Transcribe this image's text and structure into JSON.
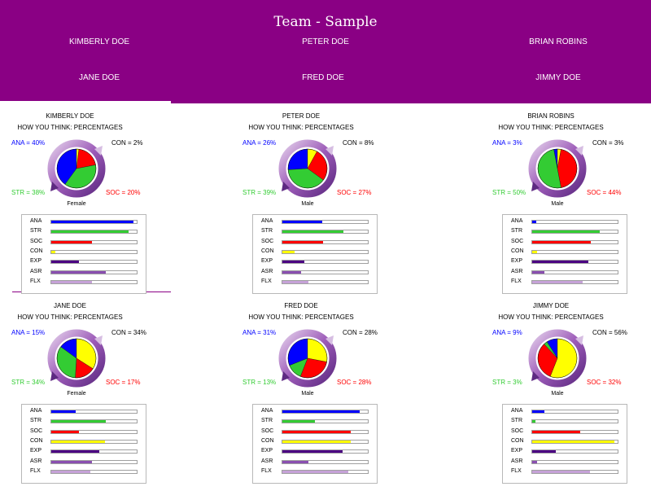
{
  "title": "Team - Sample",
  "nav": [
    "KIMBERLY DOE",
    "PETER DOE",
    "BRIAN ROBINS",
    "JANE DOE",
    "FRED DOE",
    "JIMMY DOE"
  ],
  "subtitle": "HOW YOU THINK: PERCENTAGES",
  "colors": {
    "header": "#8a0084",
    "ANA": "#0000ff",
    "STR": "#33cc33",
    "SOC": "#ff0000",
    "CON": "#ffff00",
    "EXP": "#4b0082",
    "ASR": "#8a4fb0",
    "FLX": "#c6a2d8",
    "CON_label": "#cccc00"
  },
  "bar_labels": [
    "ANA",
    "STR",
    "SOC",
    "CON",
    "EXP",
    "ASR",
    "FLX"
  ],
  "people": [
    {
      "name": "KIMBERLY DOE",
      "gender": "Female",
      "pct": {
        "ANA": "ANA = 40%",
        "CON": "CON = 2%",
        "STR": "STR = 38%",
        "SOC": "SOC = 20%"
      },
      "pie": {
        "ANA": 40,
        "CON": 2,
        "SOC": 20,
        "STR": 38
      },
      "bars": [
        0.96,
        0.9,
        0.48,
        0.05,
        0.32,
        0.64,
        0.48
      ]
    },
    {
      "name": "PETER DOE",
      "gender": "Male",
      "pct": {
        "ANA": "ANA = 26%",
        "CON": "CON = 8%",
        "STR": "STR = 39%",
        "SOC": "SOC = 27%"
      },
      "pie": {
        "ANA": 26,
        "CON": 8,
        "SOC": 27,
        "STR": 39
      },
      "bars": [
        0.47,
        0.71,
        0.48,
        0.14,
        0.26,
        0.22,
        0.3
      ]
    },
    {
      "name": "BRIAN ROBINS",
      "gender": "Male",
      "pct": {
        "ANA": "ANA = 3%",
        "CON": "CON = 3%",
        "STR": "STR = 50%",
        "SOC": "SOC = 44%"
      },
      "pie": {
        "ANA": 3,
        "CON": 3,
        "SOC": 44,
        "STR": 50
      },
      "bars": [
        0.05,
        0.79,
        0.69,
        0.06,
        0.66,
        0.14,
        0.59
      ]
    },
    {
      "name": "JANE DOE",
      "gender": "Female",
      "pct": {
        "ANA": "ANA = 15%",
        "CON": "CON = 34%",
        "STR": "STR = 34%",
        "SOC": "SOC = 17%"
      },
      "pie": {
        "ANA": 15,
        "CON": 34,
        "SOC": 17,
        "STR": 34
      },
      "bars": [
        0.29,
        0.64,
        0.32,
        0.63,
        0.56,
        0.48,
        0.46
      ]
    },
    {
      "name": "FRED DOE",
      "gender": "Male",
      "pct": {
        "ANA": "ANA = 31%",
        "CON": "CON = 28%",
        "STR": "STR = 13%",
        "SOC": "SOC = 28%"
      },
      "pie": {
        "ANA": 31,
        "CON": 28,
        "SOC": 28,
        "STR": 13
      },
      "bars": [
        0.9,
        0.38,
        0.8,
        0.8,
        0.7,
        0.3,
        0.77
      ]
    },
    {
      "name": "JIMMY DOE",
      "gender": "Male",
      "pct": {
        "ANA": "ANA = 9%",
        "CON": "CON = 56%",
        "STR": "STR = 3%",
        "SOC": "SOC = 32%"
      },
      "pie": {
        "ANA": 9,
        "CON": 56,
        "SOC": 32,
        "STR": 3
      },
      "bars": [
        0.14,
        0.04,
        0.56,
        0.96,
        0.28,
        0.06,
        0.68
      ]
    }
  ]
}
